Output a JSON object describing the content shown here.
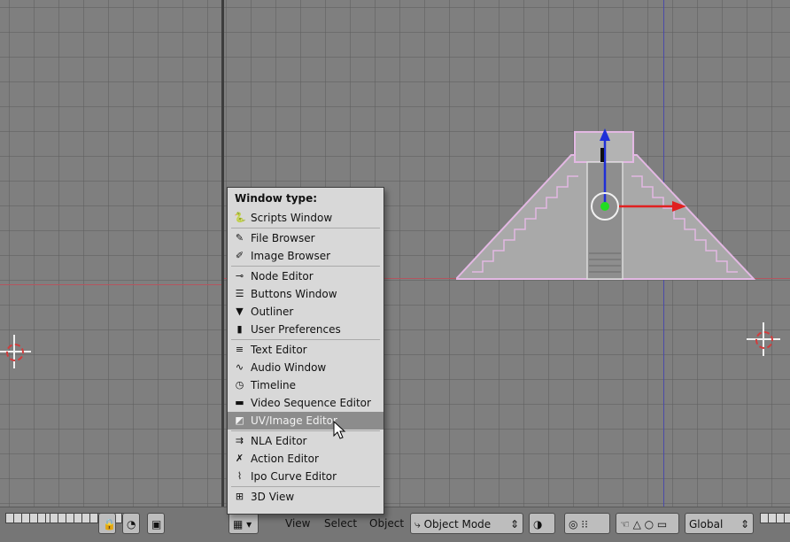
{
  "menu": {
    "title": "Window type:",
    "items": [
      {
        "label": "Scripts Window",
        "icon": "scripts-icon"
      },
      {
        "label": "File Browser",
        "icon": "file-browser-icon"
      },
      {
        "label": "Image Browser",
        "icon": "image-browser-icon"
      },
      {
        "label": "Node Editor",
        "icon": "node-editor-icon"
      },
      {
        "label": "Buttons Window",
        "icon": "buttons-window-icon"
      },
      {
        "label": "Outliner",
        "icon": "outliner-icon"
      },
      {
        "label": "User Preferences",
        "icon": "user-preferences-icon"
      },
      {
        "label": "Text Editor",
        "icon": "text-editor-icon"
      },
      {
        "label": "Audio Window",
        "icon": "audio-window-icon"
      },
      {
        "label": "Timeline",
        "icon": "timeline-icon"
      },
      {
        "label": "Video Sequence Editor",
        "icon": "video-sequence-icon"
      },
      {
        "label": "UV/Image Editor",
        "icon": "uv-image-icon",
        "selected": true
      },
      {
        "label": "NLA Editor",
        "icon": "nla-editor-icon"
      },
      {
        "label": "Action Editor",
        "icon": "action-editor-icon"
      },
      {
        "label": "Ipo Curve Editor",
        "icon": "ipo-curve-icon"
      },
      {
        "label": "3D View",
        "icon": "3d-view-icon"
      }
    ]
  },
  "header": {
    "view": "View",
    "select": "Select",
    "object": "Object",
    "mode": "Object Mode",
    "orientation": "Global"
  },
  "colors": {
    "viewport_bg": "#7f7f7f",
    "x_axis": "#b4555f",
    "y_axis": "#4a4aa8",
    "selection_outline": "#e3b8e3",
    "menu_bg": "#d8d8d8",
    "menu_selected": "#8c8c8c"
  }
}
